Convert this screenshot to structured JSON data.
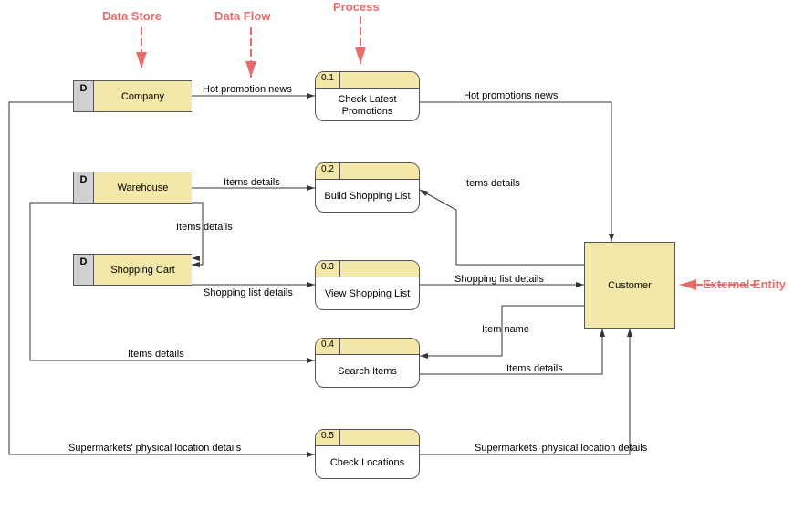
{
  "annotations": {
    "data_store": "Data Store",
    "data_flow": "Data Flow",
    "process": "Process",
    "external_entity": "External Entity"
  },
  "stores": {
    "company": {
      "tag": "D",
      "label": "Company"
    },
    "warehouse": {
      "tag": "D",
      "label": "Warehouse"
    },
    "cart": {
      "tag": "D",
      "label": "Shopping Cart"
    }
  },
  "processes": {
    "p1": {
      "num": "0.1",
      "label": "Check Latest\nPromotions"
    },
    "p2": {
      "num": "0.2",
      "label": "Build Shopping List"
    },
    "p3": {
      "num": "0.3",
      "label": "View Shopping List"
    },
    "p4": {
      "num": "0.4",
      "label": "Search Items"
    },
    "p5": {
      "num": "0.5",
      "label": "Check Locations"
    }
  },
  "entities": {
    "customer": {
      "label": "Customer"
    }
  },
  "flows": {
    "hot_promotion_news": "Hot promotion news",
    "hot_promotions_news": "Hot promotions news",
    "items_details1": "Items details",
    "items_details2": "Items details",
    "items_details3": "Items details",
    "items_details4": "Items details",
    "items_details5": "Items details",
    "shopping_list_details1": "Shopping list details",
    "shopping_list_details2": "Shopping list details",
    "item_name": "Item name",
    "loc1": "Supermarkets' physical location details",
    "loc2": "Supermarkets' physical location details"
  }
}
